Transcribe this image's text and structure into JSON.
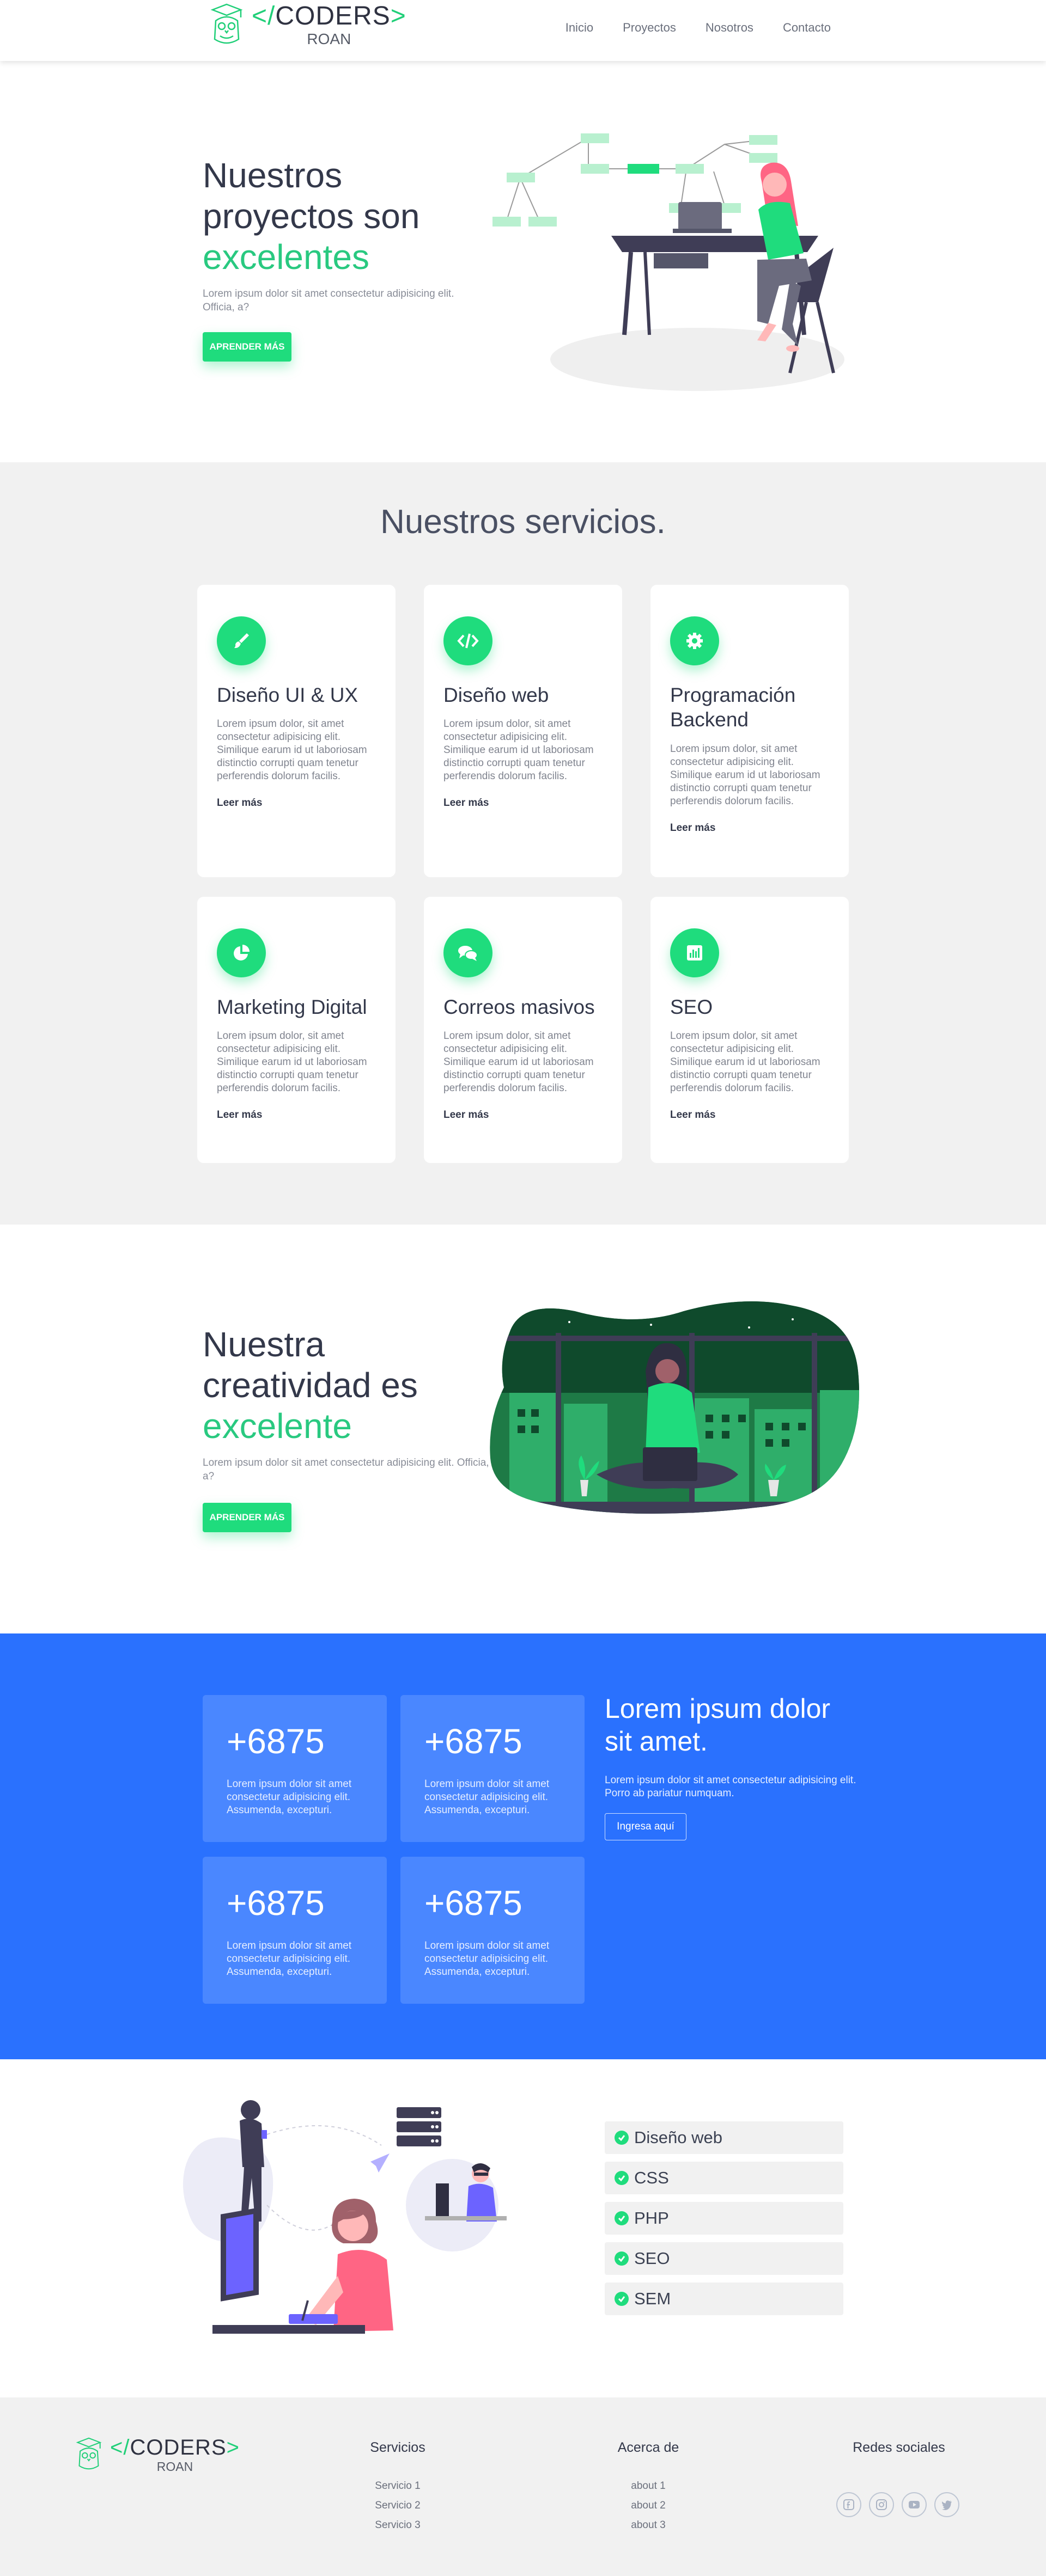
{
  "brand": {
    "prefix": "</",
    "name": "CODERS",
    "suffix": ">",
    "sub": "ROAN"
  },
  "nav": {
    "items": [
      "Inicio",
      "Proyectos",
      "Nosotros",
      "Contacto"
    ]
  },
  "hero": {
    "title_line1": "Nuestros",
    "title_line2": "proyectos son",
    "title_accent": "excelentes",
    "text": "Lorem ipsum dolor sit amet consectetur adipisicing elit. Officia, a?",
    "button": "APRENDER MÁS"
  },
  "services": {
    "title": "Nuestros servicios.",
    "cards": [
      {
        "icon": "brush-icon",
        "title": "Diseño UI & UX",
        "text": "Lorem ipsum dolor, sit amet consectetur adipisicing elit. Similique earum id ut laboriosam distinctio corrupti quam tenetur perferendis dolorum facilis.",
        "link": "Leer más"
      },
      {
        "icon": "code-icon",
        "title": "Diseño web",
        "text": "Lorem ipsum dolor, sit amet consectetur adipisicing elit. Similique earum id ut laboriosam distinctio corrupti quam tenetur perferendis dolorum facilis.",
        "link": "Leer más"
      },
      {
        "icon": "gear-icon",
        "title": "Programación Backend",
        "text": "Lorem ipsum dolor, sit amet consectetur adipisicing elit. Similique earum id ut laboriosam distinctio corrupti quam tenetur perferendis dolorum facilis.",
        "link": "Leer más"
      },
      {
        "icon": "pie-chart-icon",
        "title": "Marketing Digital",
        "text": "Lorem ipsum dolor, sit amet consectetur adipisicing elit. Similique earum id ut laboriosam distinctio corrupti quam tenetur perferendis dolorum facilis.",
        "link": "Leer más"
      },
      {
        "icon": "chat-icon",
        "title": "Correos masivos",
        "text": "Lorem ipsum dolor, sit amet consectetur adipisicing elit. Similique earum id ut laboriosam distinctio corrupti quam tenetur perferendis dolorum facilis.",
        "link": "Leer más"
      },
      {
        "icon": "bar-chart-icon",
        "title": "SEO",
        "text": "Lorem ipsum dolor, sit amet consectetur adipisicing elit. Similique earum id ut laboriosam distinctio corrupti quam tenetur perferendis dolorum facilis.",
        "link": "Leer más"
      }
    ]
  },
  "creativity": {
    "title_line1": "Nuestra",
    "title_line2": "creatividad es",
    "title_accent": "excelente",
    "text": "Lorem ipsum dolor sit amet consectetur adipisicing elit. Officia, a?",
    "button": "APRENDER MÁS"
  },
  "stats": {
    "items": [
      {
        "number": "+6875",
        "text": "Lorem ipsum dolor sit amet consectetur adipisicing elit. Assumenda, excepturi."
      },
      {
        "number": "+6875",
        "text": "Lorem ipsum dolor sit amet consectetur adipisicing elit. Assumenda, excepturi."
      },
      {
        "number": "+6875",
        "text": "Lorem ipsum dolor sit amet consectetur adipisicing elit. Assumenda, excepturi."
      },
      {
        "number": "+6875",
        "text": "Lorem ipsum dolor sit amet consectetur adipisicing elit. Assumenda, excepturi."
      }
    ],
    "title": "Lorem ipsum dolor sit amet.",
    "text": "Lorem ipsum dolor sit amet consectetur adipisicing elit. Porro ab pariatur numquam.",
    "button": "Ingresa aquí"
  },
  "skills": [
    "Diseño web",
    "CSS",
    "PHP",
    "SEO",
    "SEM"
  ],
  "footer": {
    "services": {
      "title": "Servicios",
      "items": [
        "Servicio 1",
        "Servicio 2",
        "Servicio 3"
      ]
    },
    "about": {
      "title": "Acerca de",
      "items": [
        "about 1",
        "about 2",
        "about 3"
      ]
    },
    "social": {
      "title": "Redes sociales",
      "icons": [
        "facebook-icon",
        "instagram-icon",
        "youtube-icon",
        "twitter-icon"
      ]
    }
  },
  "colors": {
    "accent_green": "#1fdc7d",
    "accent_text_green": "#29c980",
    "blue": "#2a71fe",
    "dark": "#33384a",
    "grey_bg": "#f1f1f1"
  }
}
